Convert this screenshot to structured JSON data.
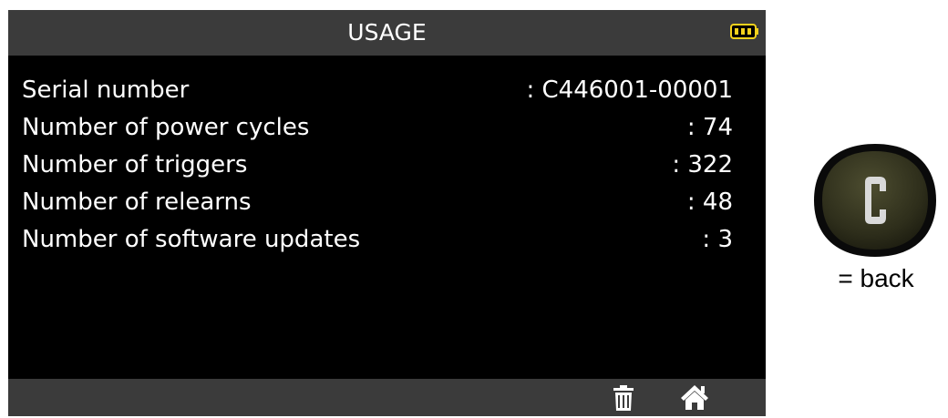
{
  "screen": {
    "title": "USAGE",
    "status_icons": [
      "battery-icon"
    ],
    "rows": [
      {
        "label": "Serial number",
        "value": ": C446001-00001"
      },
      {
        "label": "Number of power cycles",
        "value": ": 74"
      },
      {
        "label": "Number of triggers",
        "value": ": 322"
      },
      {
        "label": "Number of relearns",
        "value": ": 48"
      },
      {
        "label": "Number of software updates",
        "value": ": 3"
      }
    ],
    "bottom_icons": [
      "trash-icon",
      "home-icon"
    ]
  },
  "legend": {
    "button_letter": "C",
    "caption": "= back"
  },
  "colors": {
    "screen_background": "#000000",
    "bar_background": "#3b3b3b",
    "text": "#ffffff",
    "battery_accent": "#f5d21c",
    "button_face": "#35351f"
  }
}
